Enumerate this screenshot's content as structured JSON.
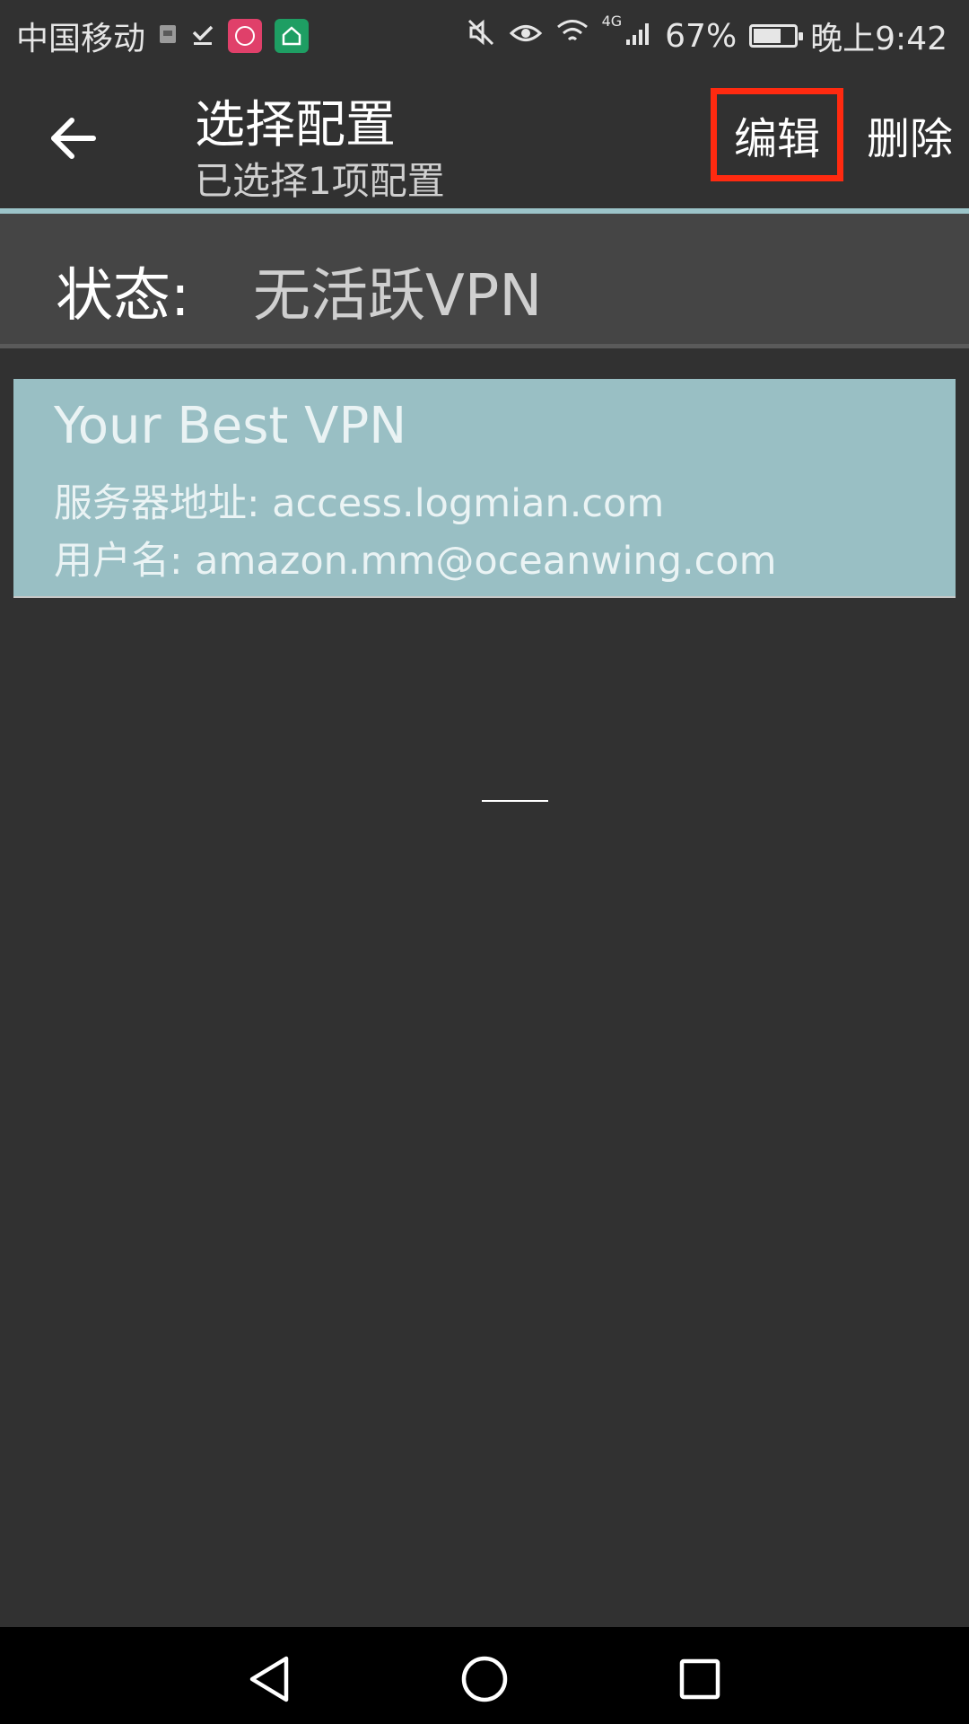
{
  "status_bar": {
    "carrier": "中国移动",
    "network": "4G",
    "battery": "67%",
    "battery_level": 0.67,
    "time": "晚上9:42"
  },
  "toolbar": {
    "title": "选择配置",
    "subtitle": "已选择1项配置",
    "edit_label": "编辑",
    "delete_label": "删除",
    "accent_color": "#9cc4c9",
    "highlight_color": "#ff2a10"
  },
  "status": {
    "label": "状态:",
    "value": "无活跃VPN"
  },
  "profiles": [
    {
      "name": "Your Best VPN",
      "server": "服务器地址: access.logmian.com",
      "username": "用户名: amazon.mm@oceanwing.com",
      "selected_color": "#99bfc4"
    }
  ]
}
